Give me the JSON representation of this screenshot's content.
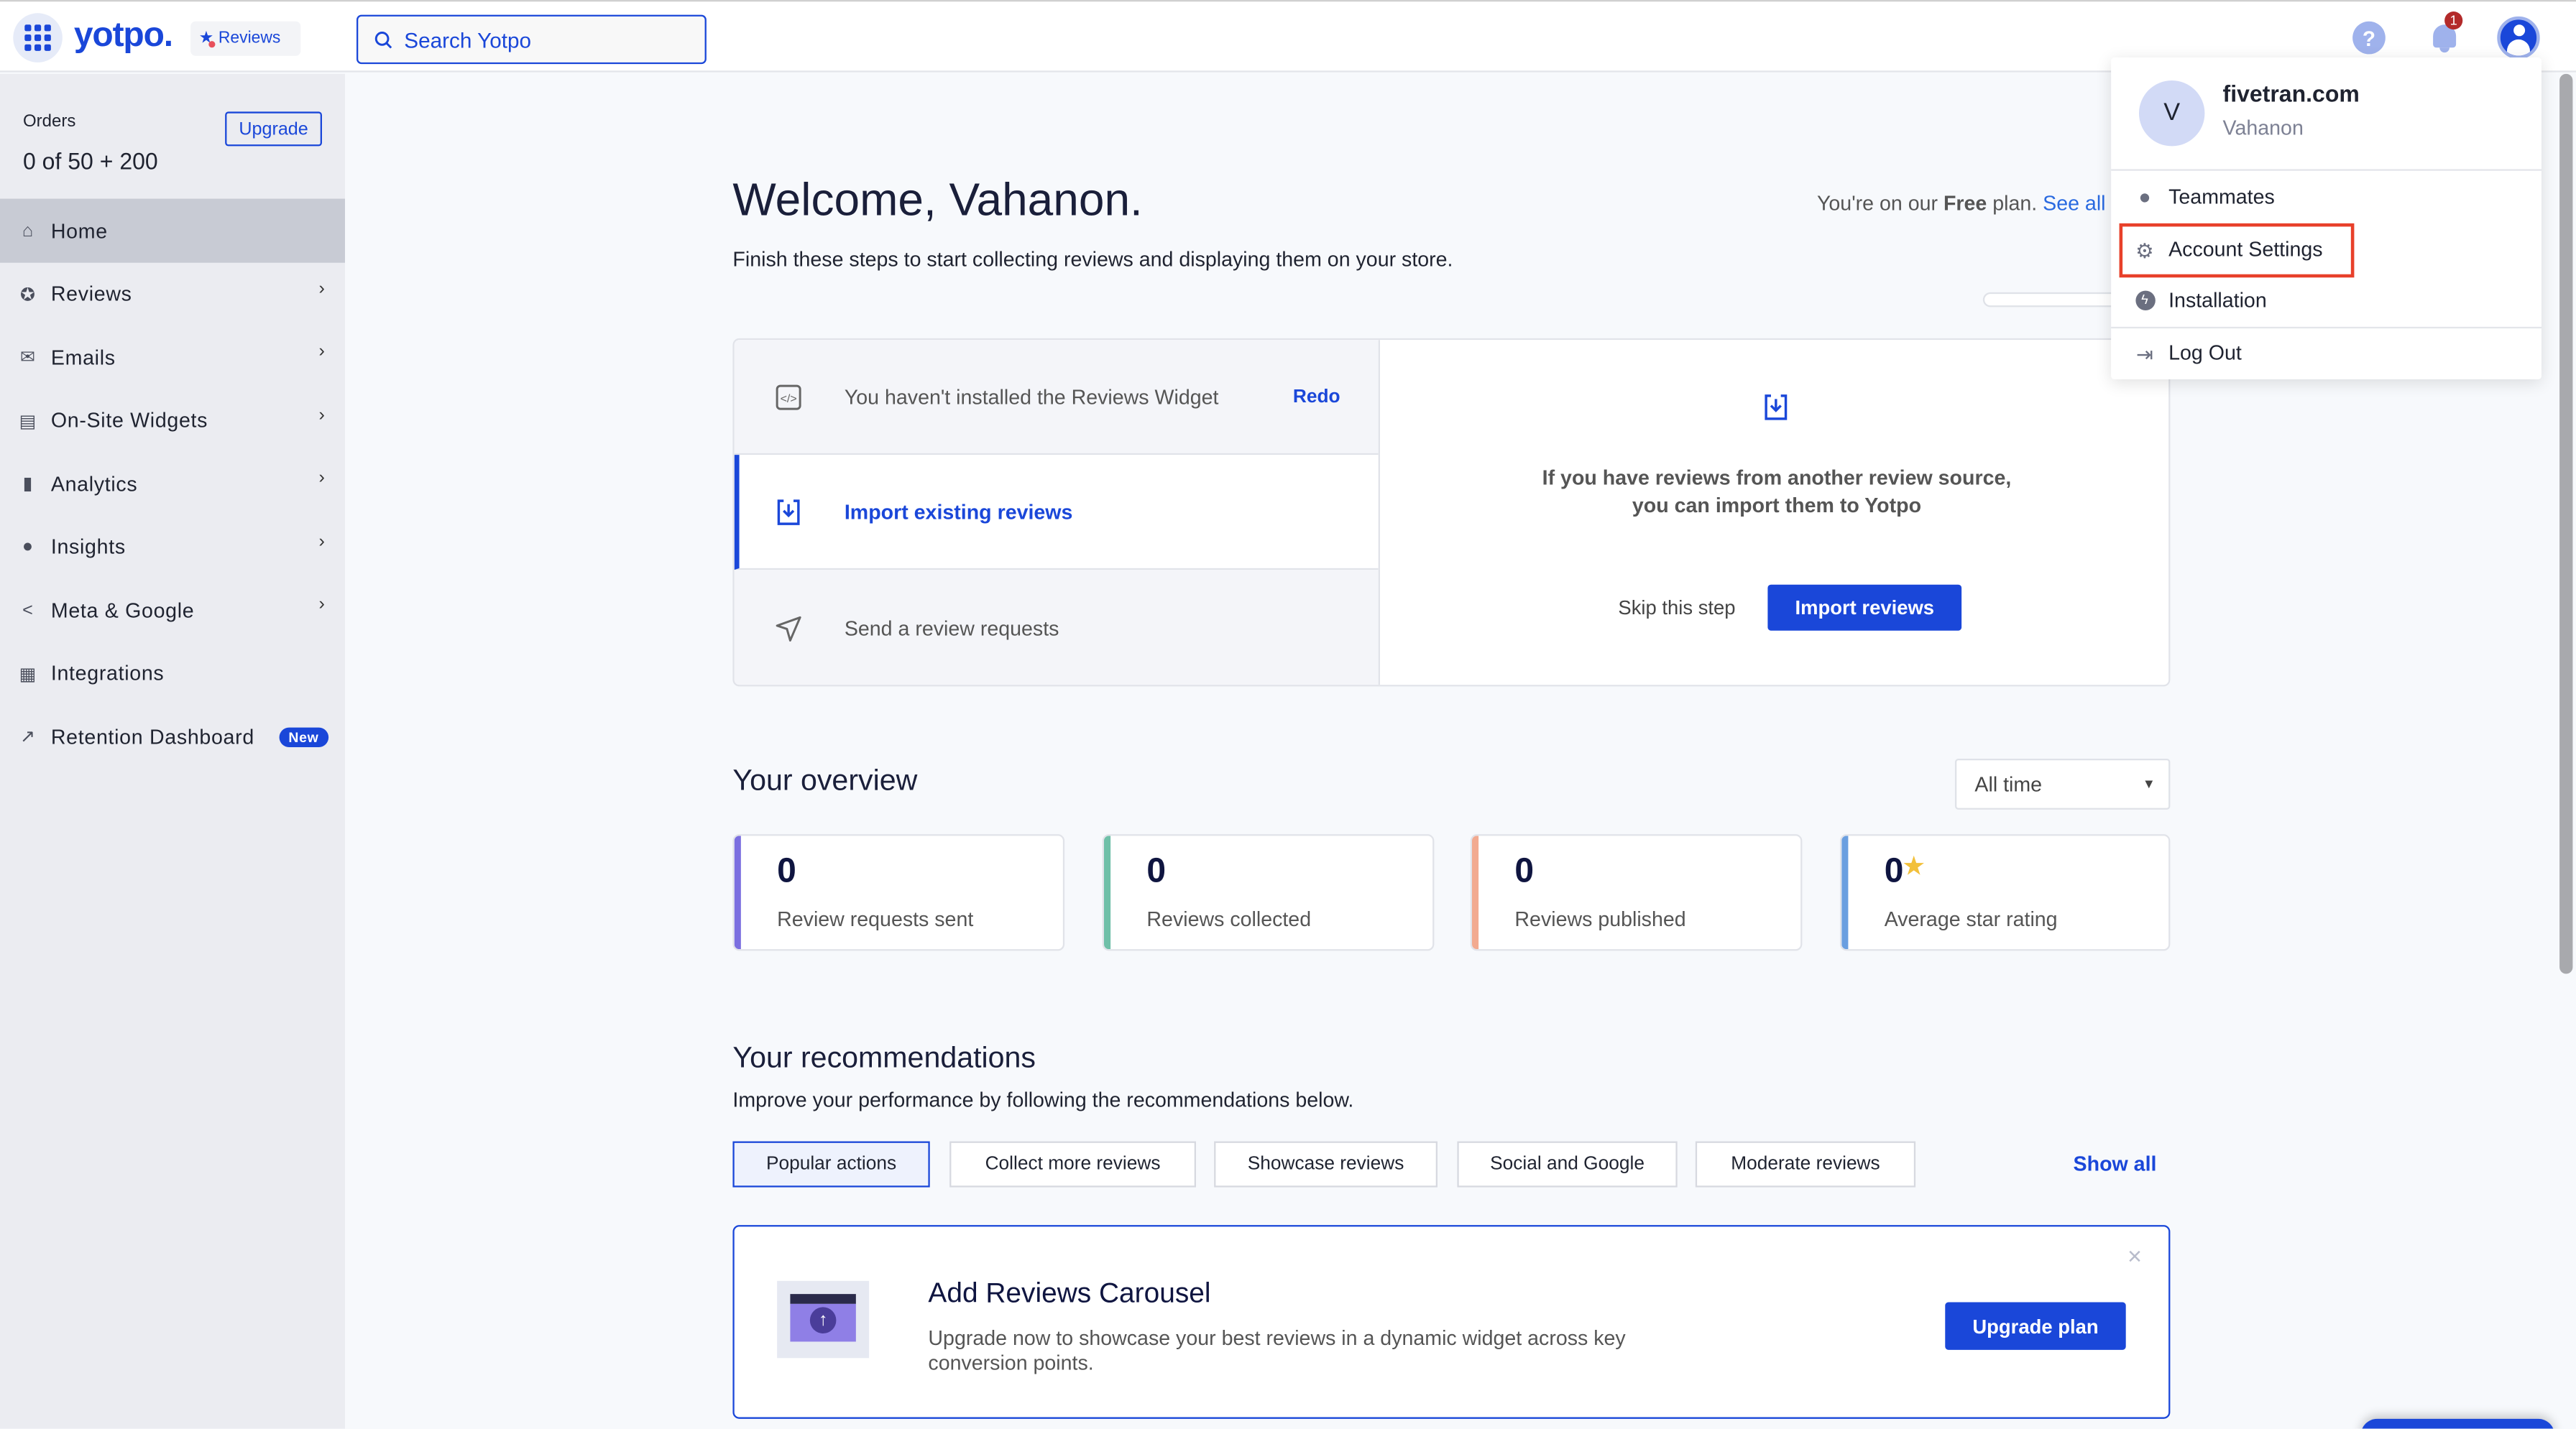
{
  "header": {
    "logo": "yotpo.",
    "product_badge": "Reviews",
    "search_placeholder": "Search Yotpo",
    "notification_count": "1"
  },
  "sidebar": {
    "orders_label": "Orders",
    "orders_value": "0 of 50 + 200",
    "upgrade_label": "Upgrade",
    "items": [
      {
        "label": "Home",
        "icon": "home-icon",
        "active": true
      },
      {
        "label": "Reviews",
        "icon": "star-circle-icon",
        "chevron": true
      },
      {
        "label": "Emails",
        "icon": "envelope-icon",
        "chevron": true
      },
      {
        "label": "On-Site Widgets",
        "icon": "widget-icon",
        "chevron": true
      },
      {
        "label": "Analytics",
        "icon": "bar-chart-icon",
        "chevron": true
      },
      {
        "label": "Insights",
        "icon": "lightbulb-icon",
        "chevron": true
      },
      {
        "label": "Meta & Google",
        "icon": "share-icon",
        "chevron": true
      },
      {
        "label": "Integrations",
        "icon": "integrations-icon"
      },
      {
        "label": "Retention Dashboard",
        "icon": "line-chart-icon",
        "badge": "New"
      }
    ]
  },
  "welcome": {
    "title": "Welcome, Vahanon.",
    "subtitle": "Finish these steps to start collecting reviews and displaying them on your store.",
    "plan_prefix": "You're on our ",
    "plan_name": "Free",
    "plan_suffix": " plan. ",
    "plan_link": "See all",
    "progress": 0
  },
  "steps": {
    "items": [
      {
        "label": "You haven't installed the Reviews Widget",
        "action": "Redo"
      },
      {
        "label": "Import existing reviews",
        "active": true
      },
      {
        "label": "Send a review requests"
      }
    ],
    "detail_text_1": "If you have reviews from another review source,",
    "detail_text_2": "you can import them to Yotpo",
    "skip_label": "Skip this step",
    "import_label": "Import reviews"
  },
  "overview": {
    "title": "Your overview",
    "period": "All time",
    "cards": [
      {
        "value": "0",
        "label": "Review requests sent",
        "color": "#7b6fe0"
      },
      {
        "value": "0",
        "label": "Reviews collected",
        "color": "#6fc0a8"
      },
      {
        "value": "0",
        "label": "Reviews published",
        "color": "#f2aa90"
      },
      {
        "value": "0",
        "label": "Average star rating",
        "color": "#6a9fe0",
        "star": "★"
      }
    ]
  },
  "recommendations": {
    "title": "Your recommendations",
    "subtitle": "Improve your performance by following the recommendations below.",
    "tabs": [
      "Popular actions",
      "Collect more reviews",
      "Showcase reviews",
      "Social and Google",
      "Moderate reviews"
    ],
    "show_all": "Show all",
    "card": {
      "title": "Add Reviews Carousel",
      "body_1": "Upgrade now to showcase your best reviews in a dynamic widget across key",
      "body_2": "conversion points.",
      "button": "Upgrade plan",
      "close": "×"
    }
  },
  "account_menu": {
    "avatar_initial": "V",
    "account": "fivetran.com",
    "user": "Vahanon",
    "items": [
      "Teammates",
      "Account Settings",
      "Installation",
      "Log Out"
    ]
  },
  "colors": {
    "brand": "#1a47d9",
    "highlight": "#e8402a"
  }
}
